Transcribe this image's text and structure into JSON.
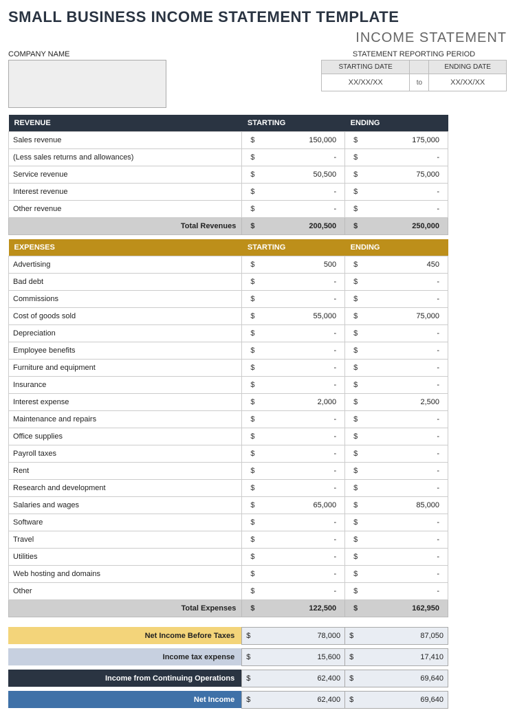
{
  "title": "SMALL BUSINESS INCOME STATEMENT TEMPLATE",
  "subtitle": "INCOME STATEMENT",
  "company_label": "COMPANY NAME",
  "period": {
    "header": "STATEMENT REPORTING PERIOD",
    "start_label": "STARTING DATE",
    "end_label": "ENDING DATE",
    "start_value": "XX/XX/XX",
    "to": "to",
    "end_value": "XX/XX/XX"
  },
  "columns": {
    "starting": "STARTING",
    "ending": "ENDING"
  },
  "currency": "$",
  "dash": "-",
  "revenue": {
    "header": "REVENUE",
    "rows": [
      {
        "label": "Sales revenue",
        "start": "150,000",
        "end": "175,000"
      },
      {
        "label": "(Less sales returns and allowances)",
        "start": "-",
        "end": "-"
      },
      {
        "label": "Service revenue",
        "start": "50,500",
        "end": "75,000"
      },
      {
        "label": "Interest revenue",
        "start": "-",
        "end": "-"
      },
      {
        "label": "Other revenue",
        "start": "-",
        "end": "-"
      }
    ],
    "total_label": "Total Revenues",
    "total_start": "200,500",
    "total_end": "250,000"
  },
  "expenses": {
    "header": "EXPENSES",
    "rows": [
      {
        "label": "Advertising",
        "start": "500",
        "end": "450"
      },
      {
        "label": "Bad debt",
        "start": "-",
        "end": "-"
      },
      {
        "label": "Commissions",
        "start": "-",
        "end": "-"
      },
      {
        "label": "Cost of goods sold",
        "start": "55,000",
        "end": "75,000"
      },
      {
        "label": "Depreciation",
        "start": "-",
        "end": "-"
      },
      {
        "label": "Employee benefits",
        "start": "-",
        "end": "-"
      },
      {
        "label": "Furniture and equipment",
        "start": "-",
        "end": "-"
      },
      {
        "label": "Insurance",
        "start": "-",
        "end": "-"
      },
      {
        "label": "Interest expense",
        "start": "2,000",
        "end": "2,500"
      },
      {
        "label": "Maintenance and repairs",
        "start": "-",
        "end": "-"
      },
      {
        "label": "Office supplies",
        "start": "-",
        "end": "-"
      },
      {
        "label": "Payroll taxes",
        "start": "-",
        "end": "-"
      },
      {
        "label": "Rent",
        "start": "-",
        "end": "-"
      },
      {
        "label": "Research and development",
        "start": "-",
        "end": "-"
      },
      {
        "label": "Salaries and wages",
        "start": "65,000",
        "end": "85,000"
      },
      {
        "label": "Software",
        "start": "-",
        "end": "-"
      },
      {
        "label": "Travel",
        "start": "-",
        "end": "-"
      },
      {
        "label": "Utilities",
        "start": "-",
        "end": "-"
      },
      {
        "label": "Web hosting and domains",
        "start": "-",
        "end": "-"
      },
      {
        "label": "Other",
        "start": "-",
        "end": "-"
      }
    ],
    "total_label": "Total Expenses",
    "total_start": "122,500",
    "total_end": "162,950"
  },
  "summary": {
    "net_before_tax": {
      "label": "Net Income Before Taxes",
      "start": "78,000",
      "end": "87,050"
    },
    "tax_expense": {
      "label": "Income tax expense",
      "start": "15,600",
      "end": "17,410"
    },
    "continuing_ops": {
      "label": "Income from Continuing Operations",
      "start": "62,400",
      "end": "69,640"
    },
    "net_income": {
      "label": "Net Income",
      "start": "62,400",
      "end": "69,640"
    }
  }
}
